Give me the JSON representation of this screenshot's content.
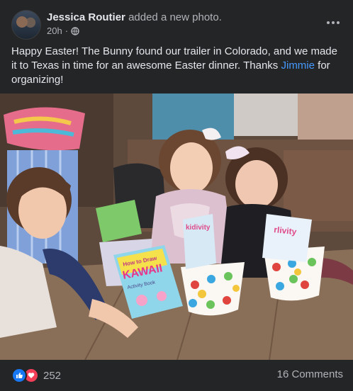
{
  "post": {
    "author": "Jessica Routier",
    "action": "added a new photo.",
    "time": "20h",
    "separator": "·",
    "privacy_icon": "globe-icon",
    "caption_text": "Happy Easter! The Bunny found our trailer in Colorado, and we made it to Texas in time for an awesome Easter dinner. Thanks ",
    "mention": "Jimmie",
    "caption_end": " for organizing!"
  },
  "photo": {
    "book_kawaii_line1": "How to Draw",
    "book_kawaii_title": "KAWAII",
    "book_activity_label": "Activity Book",
    "book_brand": "kidivity",
    "book_brand_right": "rlivity"
  },
  "footer": {
    "reaction_icons": [
      "like-icon",
      "love-icon"
    ],
    "reaction_count": "252",
    "comments": "16 Comments"
  },
  "colors": {
    "background": "#242526",
    "text": "#e4e6eb",
    "secondary": "#b0b3b8",
    "link": "#4599ff",
    "like": "#1877f2",
    "love": "#f33e58"
  }
}
